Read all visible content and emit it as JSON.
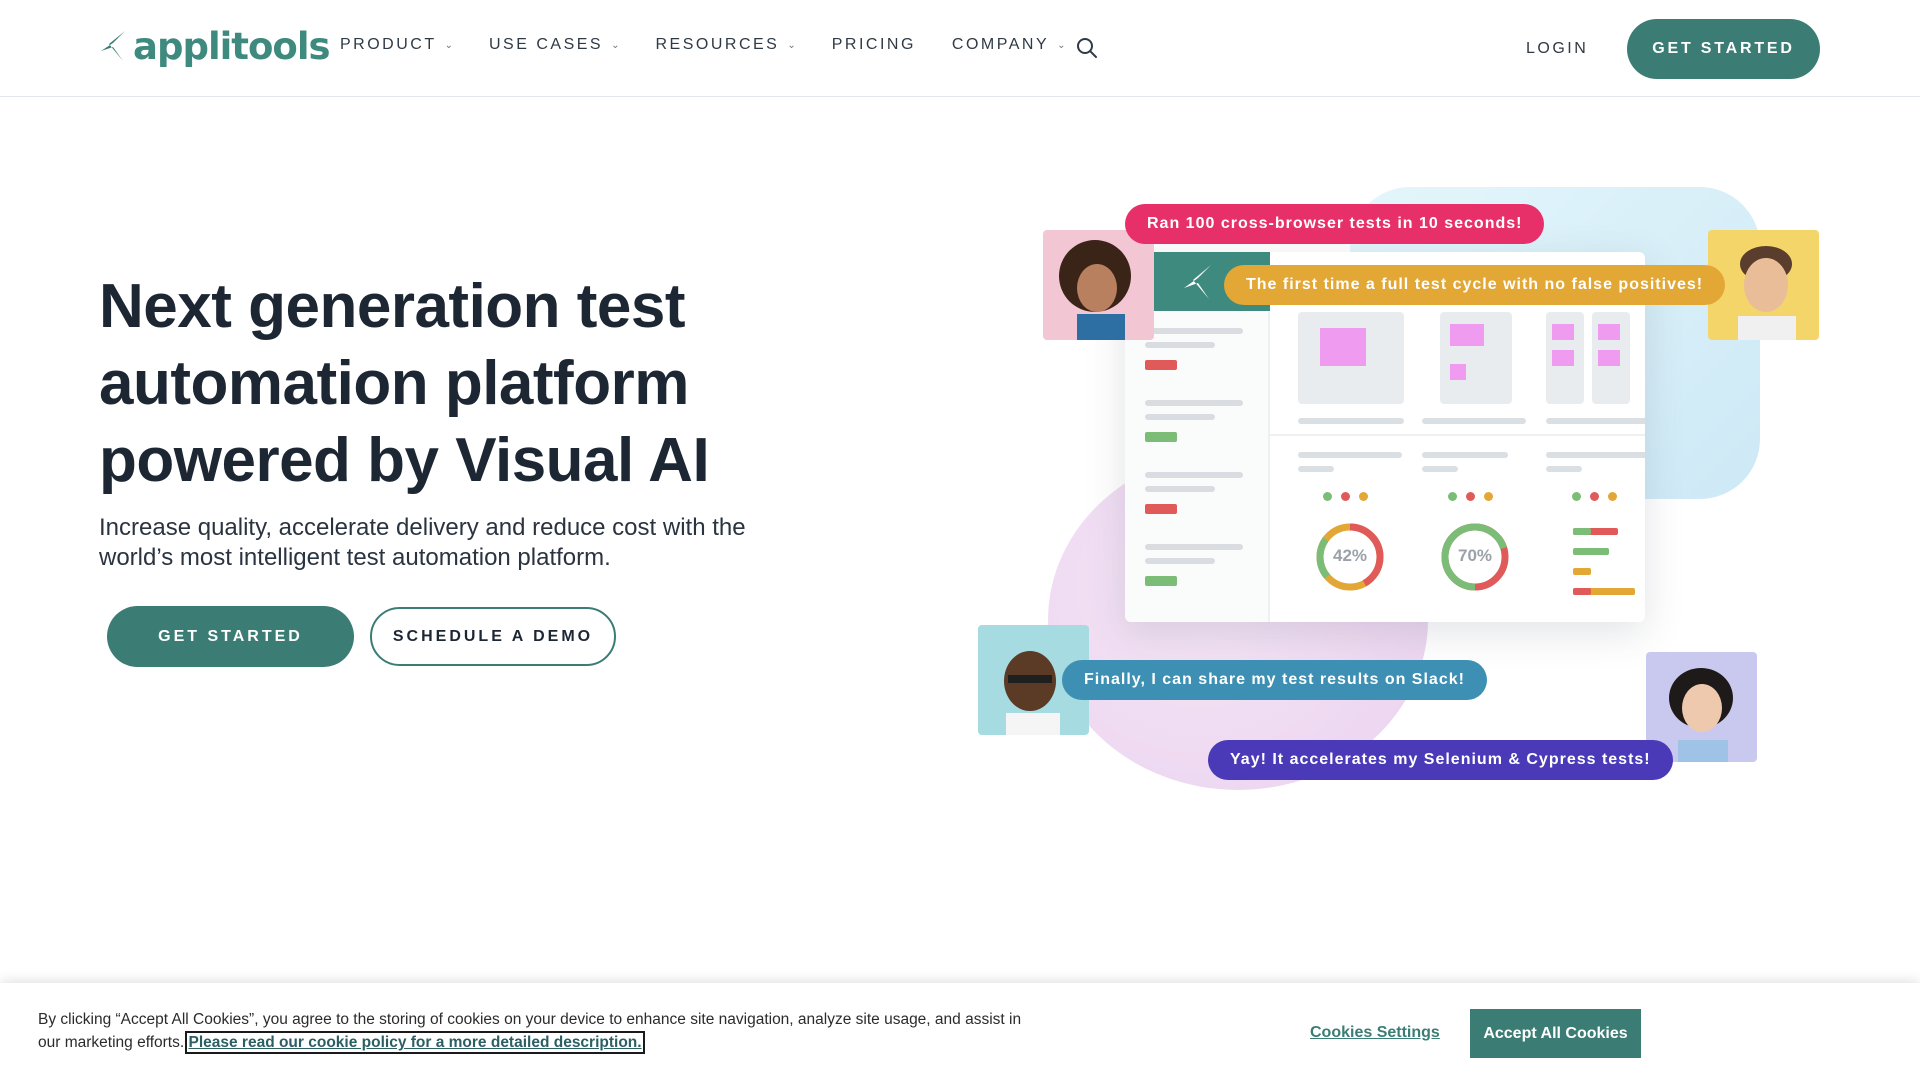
{
  "brand": {
    "name": "applitools",
    "color": "#3b7d74"
  },
  "nav": {
    "items": [
      {
        "label": "PRODUCT",
        "has_dropdown": true
      },
      {
        "label": "USE CASES",
        "has_dropdown": true
      },
      {
        "label": "RESOURCES",
        "has_dropdown": true
      },
      {
        "label": "PRICING",
        "has_dropdown": false
      },
      {
        "label": "COMPANY",
        "has_dropdown": true
      }
    ],
    "search_icon": "search-icon",
    "login_label": "LOGIN",
    "cta_label": "GET STARTED"
  },
  "hero": {
    "title": "Next generation test automation platform powered by Visual AI",
    "subtitle": "Increase quality, accelerate delivery and reduce cost with the world’s most intelligent test automation platform.",
    "primary_button": "GET STARTED",
    "secondary_button": "SCHEDULE A DEMO"
  },
  "illustration": {
    "bubbles": [
      {
        "text": "Ran 100 cross-browser tests in 10 seconds!",
        "color": "#e7306a"
      },
      {
        "text": "The first time a full test cycle with no false positives!",
        "color": "#e2a735"
      },
      {
        "text": "Finally, I can share my test results on Slack!",
        "color": "#3d8fb3"
      },
      {
        "text": "Yay! It accelerates my Selenium & Cypress tests!",
        "color": "#4a3ab8"
      }
    ],
    "gauges": [
      {
        "label": "42%",
        "value": 42
      },
      {
        "label": "70%",
        "value": 70
      }
    ]
  },
  "cookie": {
    "text": "By clicking “Accept All Cookies”, you agree to the storing of cookies on your device to enhance site navigation, analyze site usage, and assist in our marketing efforts.",
    "policy_link": "Please read our cookie policy for a more detailed description.",
    "settings_label": "Cookies Settings",
    "accept_label": "Accept All Cookies"
  }
}
